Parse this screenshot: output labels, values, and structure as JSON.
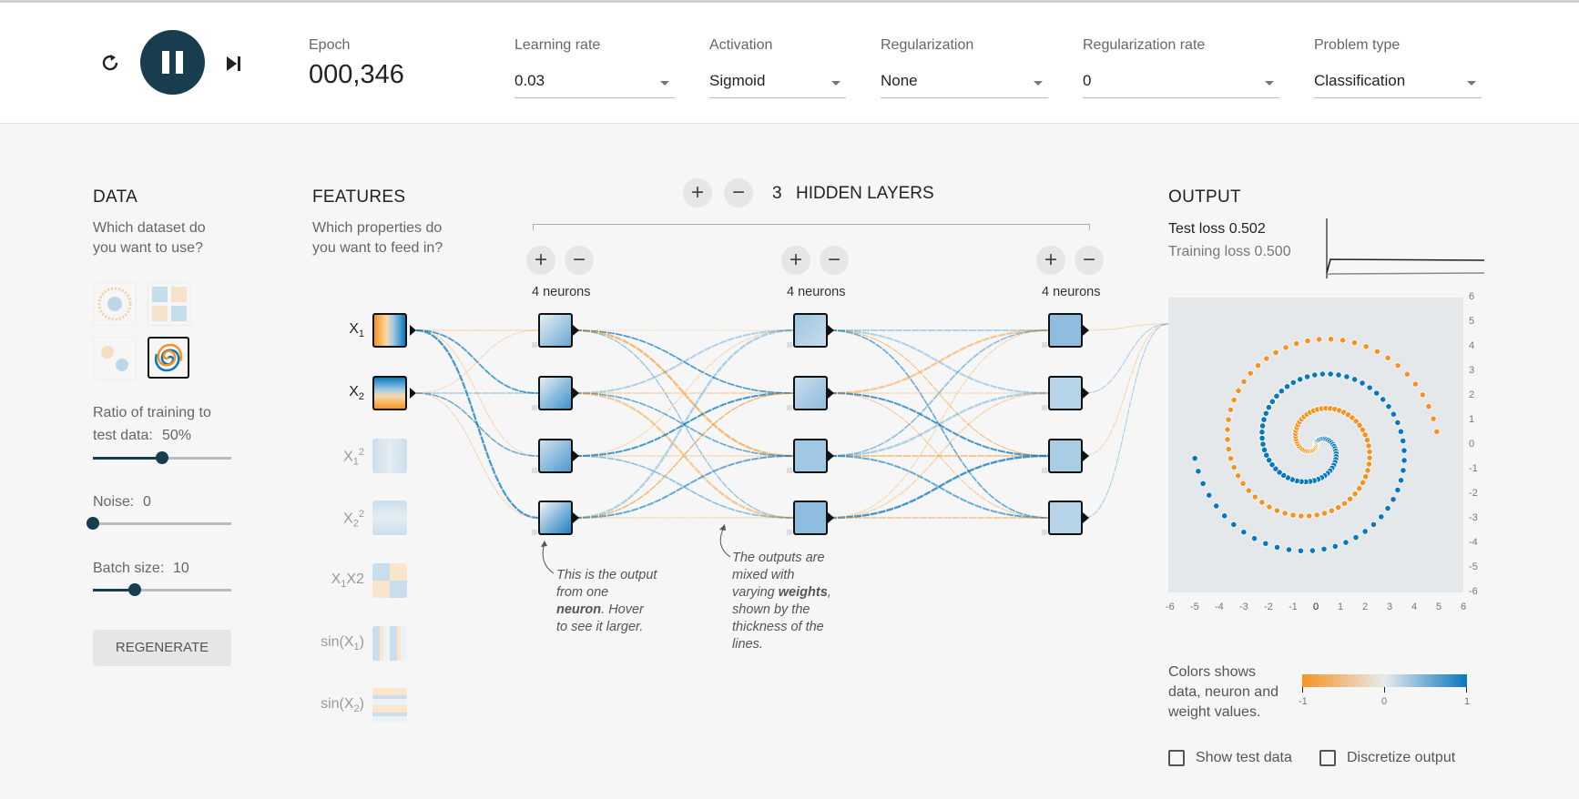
{
  "controls": {
    "epoch_label": "Epoch",
    "epoch_value": "000,346",
    "learning_rate": {
      "label": "Learning rate",
      "value": "0.03"
    },
    "activation": {
      "label": "Activation",
      "value": "Sigmoid"
    },
    "regularization": {
      "label": "Regularization",
      "value": "None"
    },
    "regularization_rate": {
      "label": "Regularization rate",
      "value": "0"
    },
    "problem_type": {
      "label": "Problem type",
      "value": "Classification"
    }
  },
  "data_panel": {
    "title": "DATA",
    "subtitle_1": "Which dataset do",
    "subtitle_2": "you want to use?",
    "ratio_label_1": "Ratio of training to",
    "ratio_label_2": "test data:",
    "ratio_value": "50%",
    "ratio_fraction": 0.5,
    "noise_label": "Noise:",
    "noise_value": "0",
    "noise_fraction": 0,
    "batch_label": "Batch size:",
    "batch_value": "10",
    "batch_fraction": 0.3,
    "regenerate_label": "REGENERATE",
    "datasets": [
      "circle-dataset-icon",
      "xor-dataset-icon",
      "gaussian-dataset-icon",
      "spiral-dataset-icon"
    ],
    "selected_dataset": "spiral-dataset-icon"
  },
  "features_panel": {
    "title": "FEATURES",
    "subtitle_1": "Which properties do",
    "subtitle_2": "you want to feed in?",
    "features": [
      {
        "base": "X",
        "sub": "1",
        "sup": "",
        "tail": "",
        "active": true
      },
      {
        "base": "X",
        "sub": "2",
        "sup": "",
        "tail": "",
        "active": true
      },
      {
        "base": "X",
        "sub": "1",
        "sup": "2",
        "tail": "",
        "active": false
      },
      {
        "base": "X",
        "sub": "2",
        "sup": "2",
        "tail": "",
        "active": false
      },
      {
        "base": "X",
        "sub": "1",
        "sup": "",
        "tail": "X2",
        "active": false
      },
      {
        "base": "sin(X",
        "sub": "1",
        "sup": "",
        "tail": ")",
        "active": false
      },
      {
        "base": "sin(X",
        "sub": "2",
        "sup": "",
        "tail": ")",
        "active": false
      }
    ]
  },
  "network": {
    "layer_count": "3",
    "hidden_layers_label": "HIDDEN LAYERS",
    "layers": [
      {
        "neurons_label": "4 neurons"
      },
      {
        "neurons_label": "4 neurons"
      },
      {
        "neurons_label": "4 neurons"
      }
    ],
    "note_neuron": [
      "This is the output",
      "from one",
      "neuron",
      ". Hover",
      "to see it larger."
    ],
    "note_weights": [
      "The outputs are",
      "mixed with",
      "varying ",
      "weights",
      ",",
      "shown by the",
      "thickness of the",
      "lines."
    ]
  },
  "output_panel": {
    "title": "OUTPUT",
    "test_loss": "Test loss 0.502",
    "training_loss": "Training loss 0.500",
    "axis_ticks": [
      "-6",
      "-5",
      "-4",
      "-3",
      "-2",
      "-1",
      "0",
      "1",
      "2",
      "3",
      "4",
      "5",
      "6"
    ],
    "y_axis_ticks": [
      "6",
      "5",
      "4",
      "3",
      "2",
      "1",
      "0",
      "-1",
      "-2",
      "-3",
      "-4",
      "-5",
      "-6"
    ],
    "legend_text_1": "Colors shows",
    "legend_text_2": "data, neuron and",
    "legend_text_3": "weight values.",
    "legend_ticks": [
      "-1",
      "0",
      "1"
    ],
    "show_test_data": "Show test data",
    "discretize_output": "Discretize output"
  },
  "colors": {
    "orange": "#f59322",
    "blue": "#0877bd",
    "dark": "#183d4e"
  }
}
